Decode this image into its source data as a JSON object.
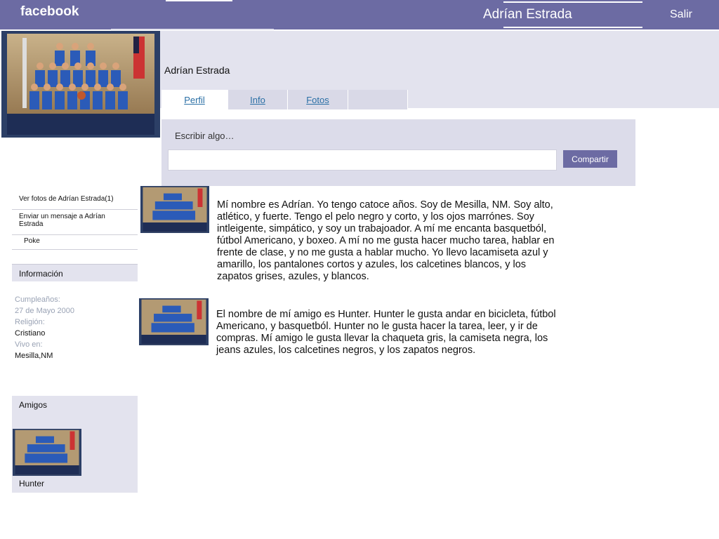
{
  "brand": {
    "logo": "facebook",
    "color": "#6c6ba3"
  },
  "topbar": {
    "user_name": "Adrían Estrada",
    "logout_label": "Salir"
  },
  "profile": {
    "name": "Adrían Estrada"
  },
  "tabs": [
    {
      "label": "Perfil",
      "active": true
    },
    {
      "label": "Info",
      "active": false
    },
    {
      "label": "Fotos",
      "active": false
    },
    {
      "label": "",
      "active": false
    }
  ],
  "composer": {
    "label": "Escribir algo…",
    "input_value": "",
    "share_label": "Compartir"
  },
  "sidebar": {
    "links": [
      {
        "label": "Ver fotos de  Adrían Estrada(1)"
      },
      {
        "label": "Enviar un mensaje a Adrían Estrada"
      },
      {
        "label": "Poke"
      }
    ],
    "info": {
      "title": "Información",
      "birthday_label": "Cumpleaños:",
      "birthday_value": "27 de Mayo 2000",
      "religion_label": "Religión:",
      "religion_value": "Cristiano",
      "lives_label": "Vivo en:",
      "lives_value": "Mesilla,NM"
    },
    "friends": {
      "title": "Amigos",
      "items": [
        {
          "name": "Hunter"
        }
      ]
    }
  },
  "posts": [
    {
      "text": "Mí nombre es Adrían. Yo tengo catoce años. Soy de Mesilla, NM. Soy alto, atlético, y fuerte. Tengo el pelo negro y corto, y los ojos marrónes. Soy intleigente, simpático, y soy un trabajoador. A mí me encanta basquetból, fútbol Americano, y boxeo. A mí no me gusta hacer mucho tarea, hablar en frente de clase, y no me gusta a hablar mucho. Yo llevo lacamiseta azul y  amarillo, los pantalones cortos y azules, los calcetines blancos, y los zapatos grises, azules, y blancos."
    },
    {
      "text": "El nombre de mí amigo es Hunter. Hunter le gusta andar en bicicleta, fútbol Americano, y basquetból. Hunter no le gusta hacer la tarea, leer, y ir de compras. Mí amigo le gusta llevar la chaqueta gris, la camiseta negra, los jeans azules, los calcetines negros, y los zapatos negros."
    }
  ]
}
